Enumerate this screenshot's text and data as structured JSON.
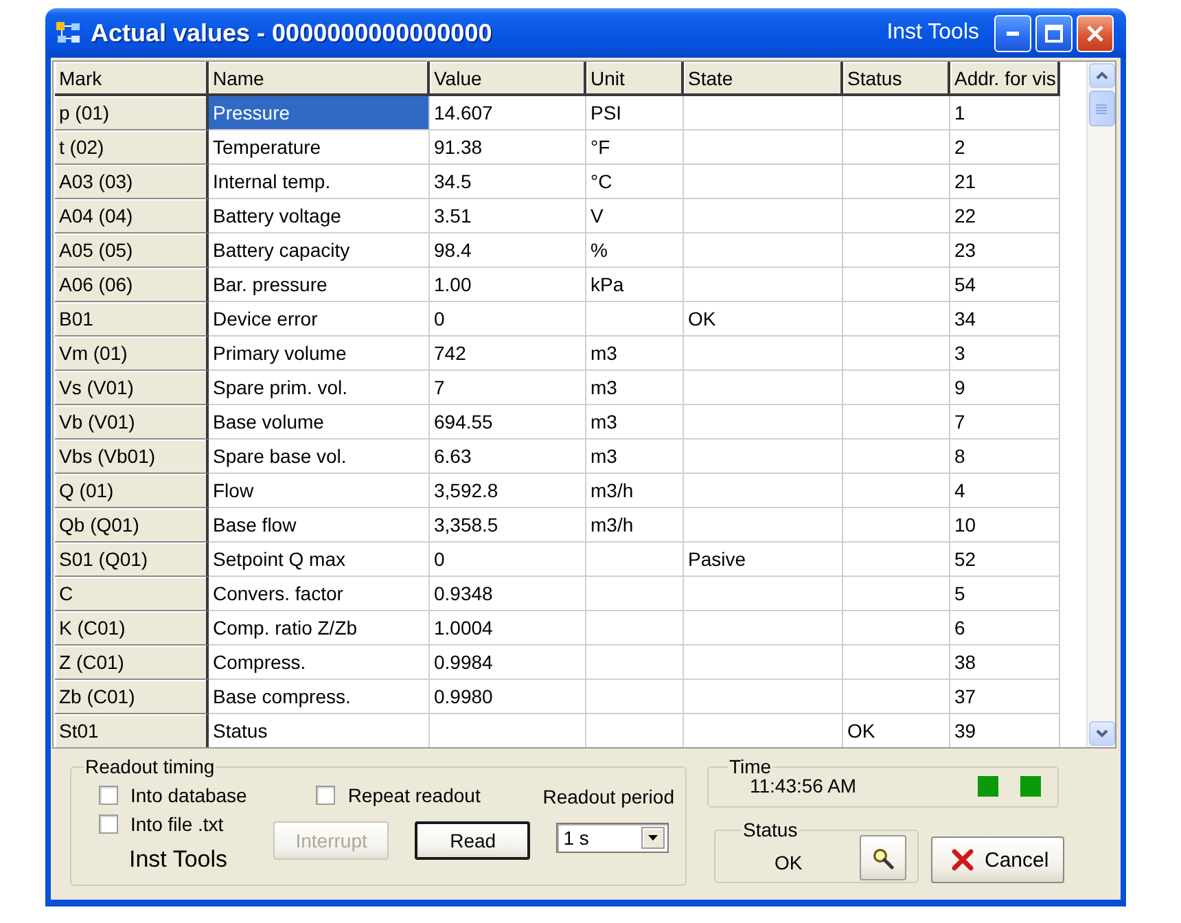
{
  "window": {
    "title": "Actual values - 0000000000000000",
    "app_name": "Inst Tools"
  },
  "table": {
    "columns": [
      "Mark",
      "Name",
      "Value",
      "Unit",
      "State",
      "Status",
      "Addr. for vis"
    ],
    "rows": [
      {
        "mark": "p (01)",
        "name": "Pressure",
        "value": "14.607",
        "unit": "PSI",
        "addr": "1",
        "selected": true
      },
      {
        "mark": "t (02)",
        "name": "Temperature",
        "value": "91.38",
        "unit": "°F",
        "addr": "2",
        "selected": false
      },
      {
        "mark": "A03 (03)",
        "name": "Internal temp.",
        "value": "34.5",
        "unit": "°C",
        "addr": "21",
        "selected": false
      },
      {
        "mark": "A04 (04)",
        "name": "Battery voltage",
        "value": "3.51",
        "unit": "V",
        "addr": "22",
        "selected": false
      },
      {
        "mark": "A05 (05)",
        "name": "Battery capacity",
        "value": "98.4",
        "unit": "%",
        "addr": "23",
        "selected": false
      },
      {
        "mark": "A06 (06)",
        "name": "Bar. pressure",
        "value": "1.00",
        "unit": "kPa",
        "addr": "54",
        "selected": false
      },
      {
        "mark": "B01",
        "name": "Device error",
        "value": "0",
        "state": "OK",
        "addr": "34",
        "selected": false
      },
      {
        "mark": "Vm (01)",
        "name": "Primary volume",
        "value": "742",
        "unit": "m3",
        "addr": "3",
        "selected": false
      },
      {
        "mark": "Vs (V01)",
        "name": "Spare prim. vol.",
        "value": "7",
        "unit": "m3",
        "addr": "9",
        "selected": false
      },
      {
        "mark": "Vb (V01)",
        "name": "Base volume",
        "value": "694.55",
        "unit": "m3",
        "addr": "7",
        "selected": false
      },
      {
        "mark": "Vbs (Vb01)",
        "name": "Spare base vol.",
        "value": "6.63",
        "unit": "m3",
        "addr": "8",
        "selected": false
      },
      {
        "mark": "Q (01)",
        "name": "Flow",
        "value": "3,592.8",
        "unit": "m3/h",
        "addr": "4",
        "selected": false
      },
      {
        "mark": "Qb (Q01)",
        "name": "Base flow",
        "value": "3,358.5",
        "unit": "m3/h",
        "addr": "10",
        "selected": false
      },
      {
        "mark": "S01 (Q01)",
        "name": "Setpoint Q max",
        "value": "0",
        "state": "Pasive",
        "addr": "52",
        "selected": false
      },
      {
        "mark": "C",
        "name": "Convers. factor",
        "value": "0.9348",
        "addr": "5",
        "selected": false
      },
      {
        "mark": "K (C01)",
        "name": "Comp. ratio Z/Zb",
        "value": "1.0004",
        "addr": "6",
        "selected": false
      },
      {
        "mark": "Z (C01)",
        "name": "Compress.",
        "value": "0.9984",
        "addr": "38",
        "selected": false
      },
      {
        "mark": "Zb (C01)",
        "name": "Base compress.",
        "value": "0.9980",
        "addr": "37",
        "selected": false
      },
      {
        "mark": "St01",
        "name": "Status",
        "status": "OK",
        "addr": "39",
        "selected": false
      }
    ]
  },
  "readout_timing": {
    "title": "Readout timing",
    "checkboxes": [
      {
        "label": "Into database",
        "checked": false
      },
      {
        "label": "Into file .txt",
        "checked": false
      }
    ],
    "brand": "Inst Tools",
    "repeat": {
      "label": "Repeat readout",
      "checked": false
    },
    "buttons": [
      {
        "label": "Interrupt",
        "disabled": true,
        "default": false
      },
      {
        "label": "Read",
        "disabled": false,
        "default": true
      }
    ],
    "period": {
      "label": "Readout period",
      "value": "1 s"
    }
  },
  "time": {
    "title": "Time",
    "value": "11:43:56 AM",
    "indicators": [
      {
        "on": true
      },
      {
        "on": true
      }
    ]
  },
  "status": {
    "title": "Status",
    "value": "OK"
  },
  "cancel_button": {
    "label": "Cancel"
  }
}
